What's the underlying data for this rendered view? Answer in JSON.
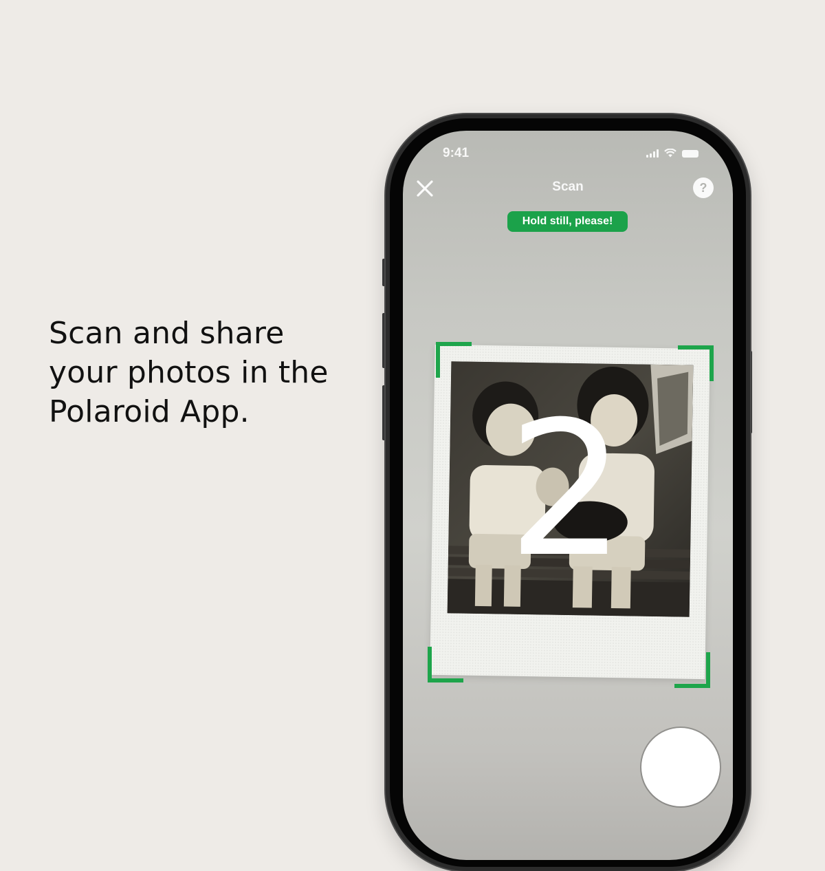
{
  "headline": {
    "line1": "Scan and share",
    "line2": "your photos in the",
    "line3": "Polaroid App."
  },
  "status_bar": {
    "time": "9:41",
    "icons": [
      "signal-icon",
      "wifi-icon",
      "battery-icon"
    ]
  },
  "nav": {
    "title": "Scan",
    "close_icon": "close-icon",
    "help_label": "?"
  },
  "toast": {
    "text": "Hold still, please!"
  },
  "scan": {
    "countdown": "2",
    "photo_description_icon": "photo-image"
  },
  "colors": {
    "background": "#eeebe7",
    "accent_green": "#1ba24a",
    "phone_frame": "#050505"
  }
}
